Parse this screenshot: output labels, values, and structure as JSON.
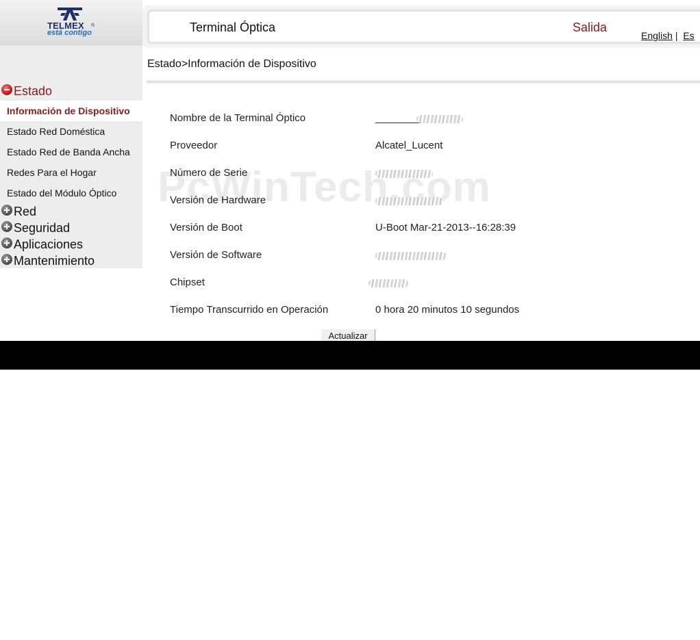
{
  "logo": {
    "brand": "TELMEX",
    "registered": "®",
    "tagline": "está contigo"
  },
  "header": {
    "title": "Terminal Óptica",
    "logout": "Salida",
    "lang_english": "English",
    "lang_separator": "|",
    "lang_spanish": "Es"
  },
  "breadcrumb": "Estado>Información de Dispositivo",
  "watermark": "PcWinTech.com",
  "sidebar": {
    "categories": [
      {
        "label": "Estado",
        "expanded": true
      },
      {
        "label": "Red",
        "expanded": false
      },
      {
        "label": "Seguridad",
        "expanded": false
      },
      {
        "label": "Aplicaciones",
        "expanded": false
      },
      {
        "label": "Mantenimiento",
        "expanded": false
      }
    ],
    "estado_items": [
      {
        "label": "Información de Dispositivo",
        "active": true
      },
      {
        "label": "Estado Red Doméstica"
      },
      {
        "label": "Estado Red de Banda Ancha"
      },
      {
        "label": "Redes Para el Hogar"
      },
      {
        "label": "Estado del Módulo Óptico"
      }
    ]
  },
  "device_info": [
    {
      "label": "Nombre de la Terminal Óptico",
      "value": "________",
      "redacted": true
    },
    {
      "label": "Proveedor",
      "value": "Alcatel_Lucent"
    },
    {
      "label": "Número de Serie",
      "value": "",
      "redacted": true
    },
    {
      "label": "Versión de Hardware",
      "value": "",
      "redacted": true
    },
    {
      "label": "Versión de Boot",
      "value": "U-Boot Mar-21-2013--16:28:39"
    },
    {
      "label": "Versión de Software",
      "value": "",
      "redacted": true
    },
    {
      "label": "Chipset",
      "value": "",
      "redacted": true
    },
    {
      "label": "Tiempo Transcurrido en Operación",
      "value": "0 hora 20 minutos 10 segundos"
    }
  ],
  "refresh_button": "Actualizar",
  "colors": {
    "accent": "#8b1a1a",
    "sidebar_bg": "#ededed",
    "footer": "#000000"
  }
}
